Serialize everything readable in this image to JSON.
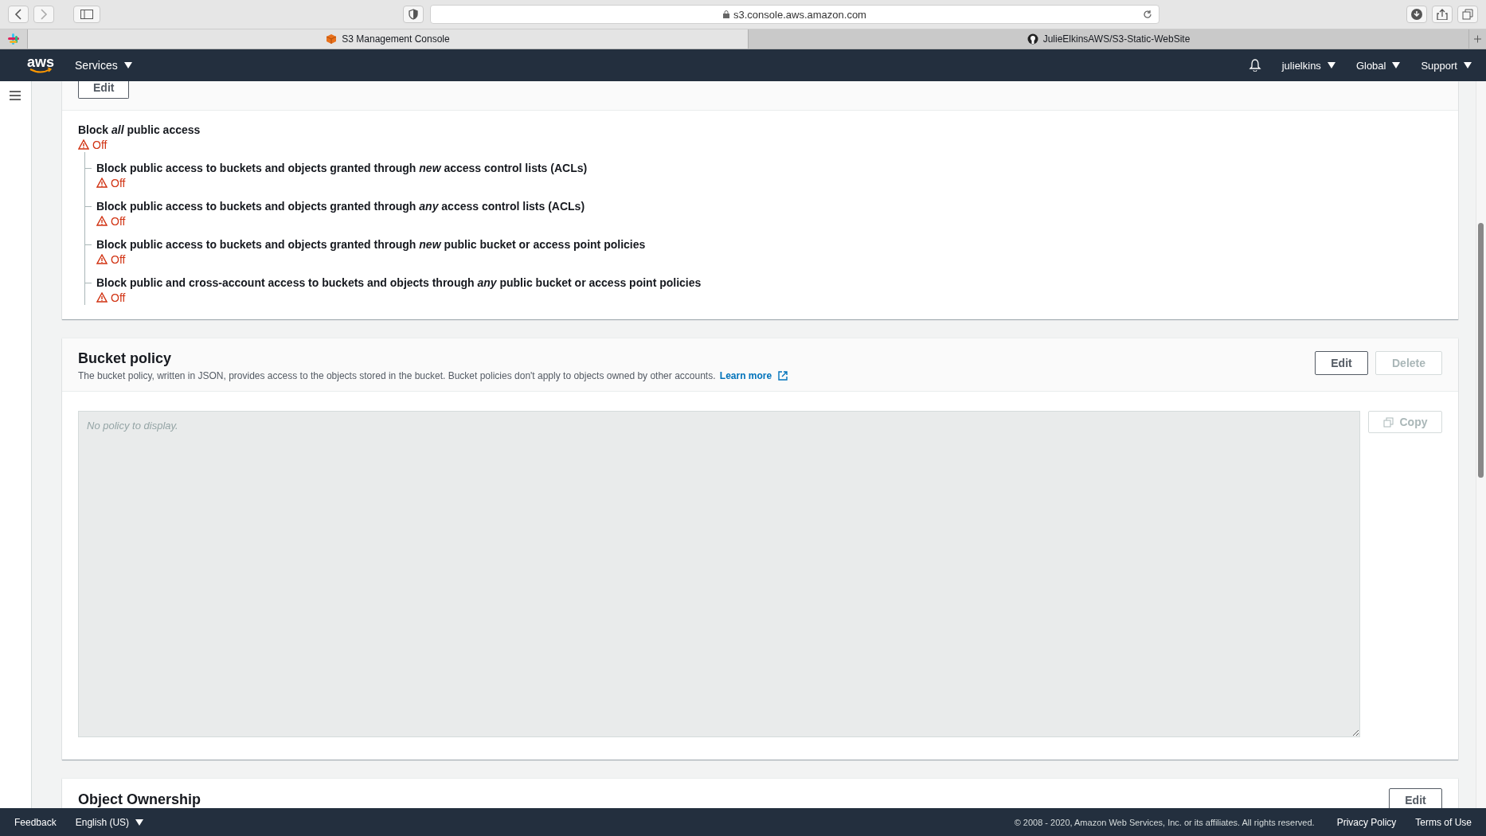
{
  "browser": {
    "address": "s3.console.aws.amazon.com",
    "tabs": [
      {
        "label": "S3 Management Console",
        "selected": true
      },
      {
        "label": "JulieElkinsAWS/S3-Static-WebSite",
        "selected": false
      }
    ]
  },
  "top_nav": {
    "logo": "aws",
    "services": "Services",
    "user": "julielkins",
    "region": "Global",
    "support": "Support"
  },
  "public_access": {
    "edit_label": "Edit",
    "title": "Block *all* public access",
    "status": "Off",
    "children": [
      {
        "title": "Block public access to buckets and objects granted through *new* access control lists (ACLs)",
        "status": "Off"
      },
      {
        "title": "Block public access to buckets and objects granted through *any* access control lists (ACLs)",
        "status": "Off"
      },
      {
        "title": "Block public access to buckets and objects granted through *new* public bucket or access point policies",
        "status": "Off"
      },
      {
        "title": "Block public and cross-account access to buckets and objects through *any* public bucket or access point policies",
        "status": "Off"
      }
    ]
  },
  "bucket_policy": {
    "title": "Bucket policy",
    "description": "The bucket policy, written in JSON, provides access to the objects stored in the bucket. Bucket policies don't apply to objects owned by other accounts.",
    "learn_more": "Learn more",
    "buttons": [
      {
        "label": "Edit",
        "disabled": false
      },
      {
        "label": "Delete",
        "disabled": true
      }
    ],
    "placeholder": "No policy to display.",
    "copy": {
      "label": "Copy",
      "disabled": true
    }
  },
  "object_ownership": {
    "title": "Object Ownership",
    "edit_label": "Edit"
  },
  "footer": {
    "feedback": "Feedback",
    "language": "English (US)",
    "copyright": "© 2008 - 2020, Amazon Web Services, Inc. or its affiliates. All rights reserved.",
    "links": [
      "Privacy Policy",
      "Terms of Use"
    ]
  }
}
